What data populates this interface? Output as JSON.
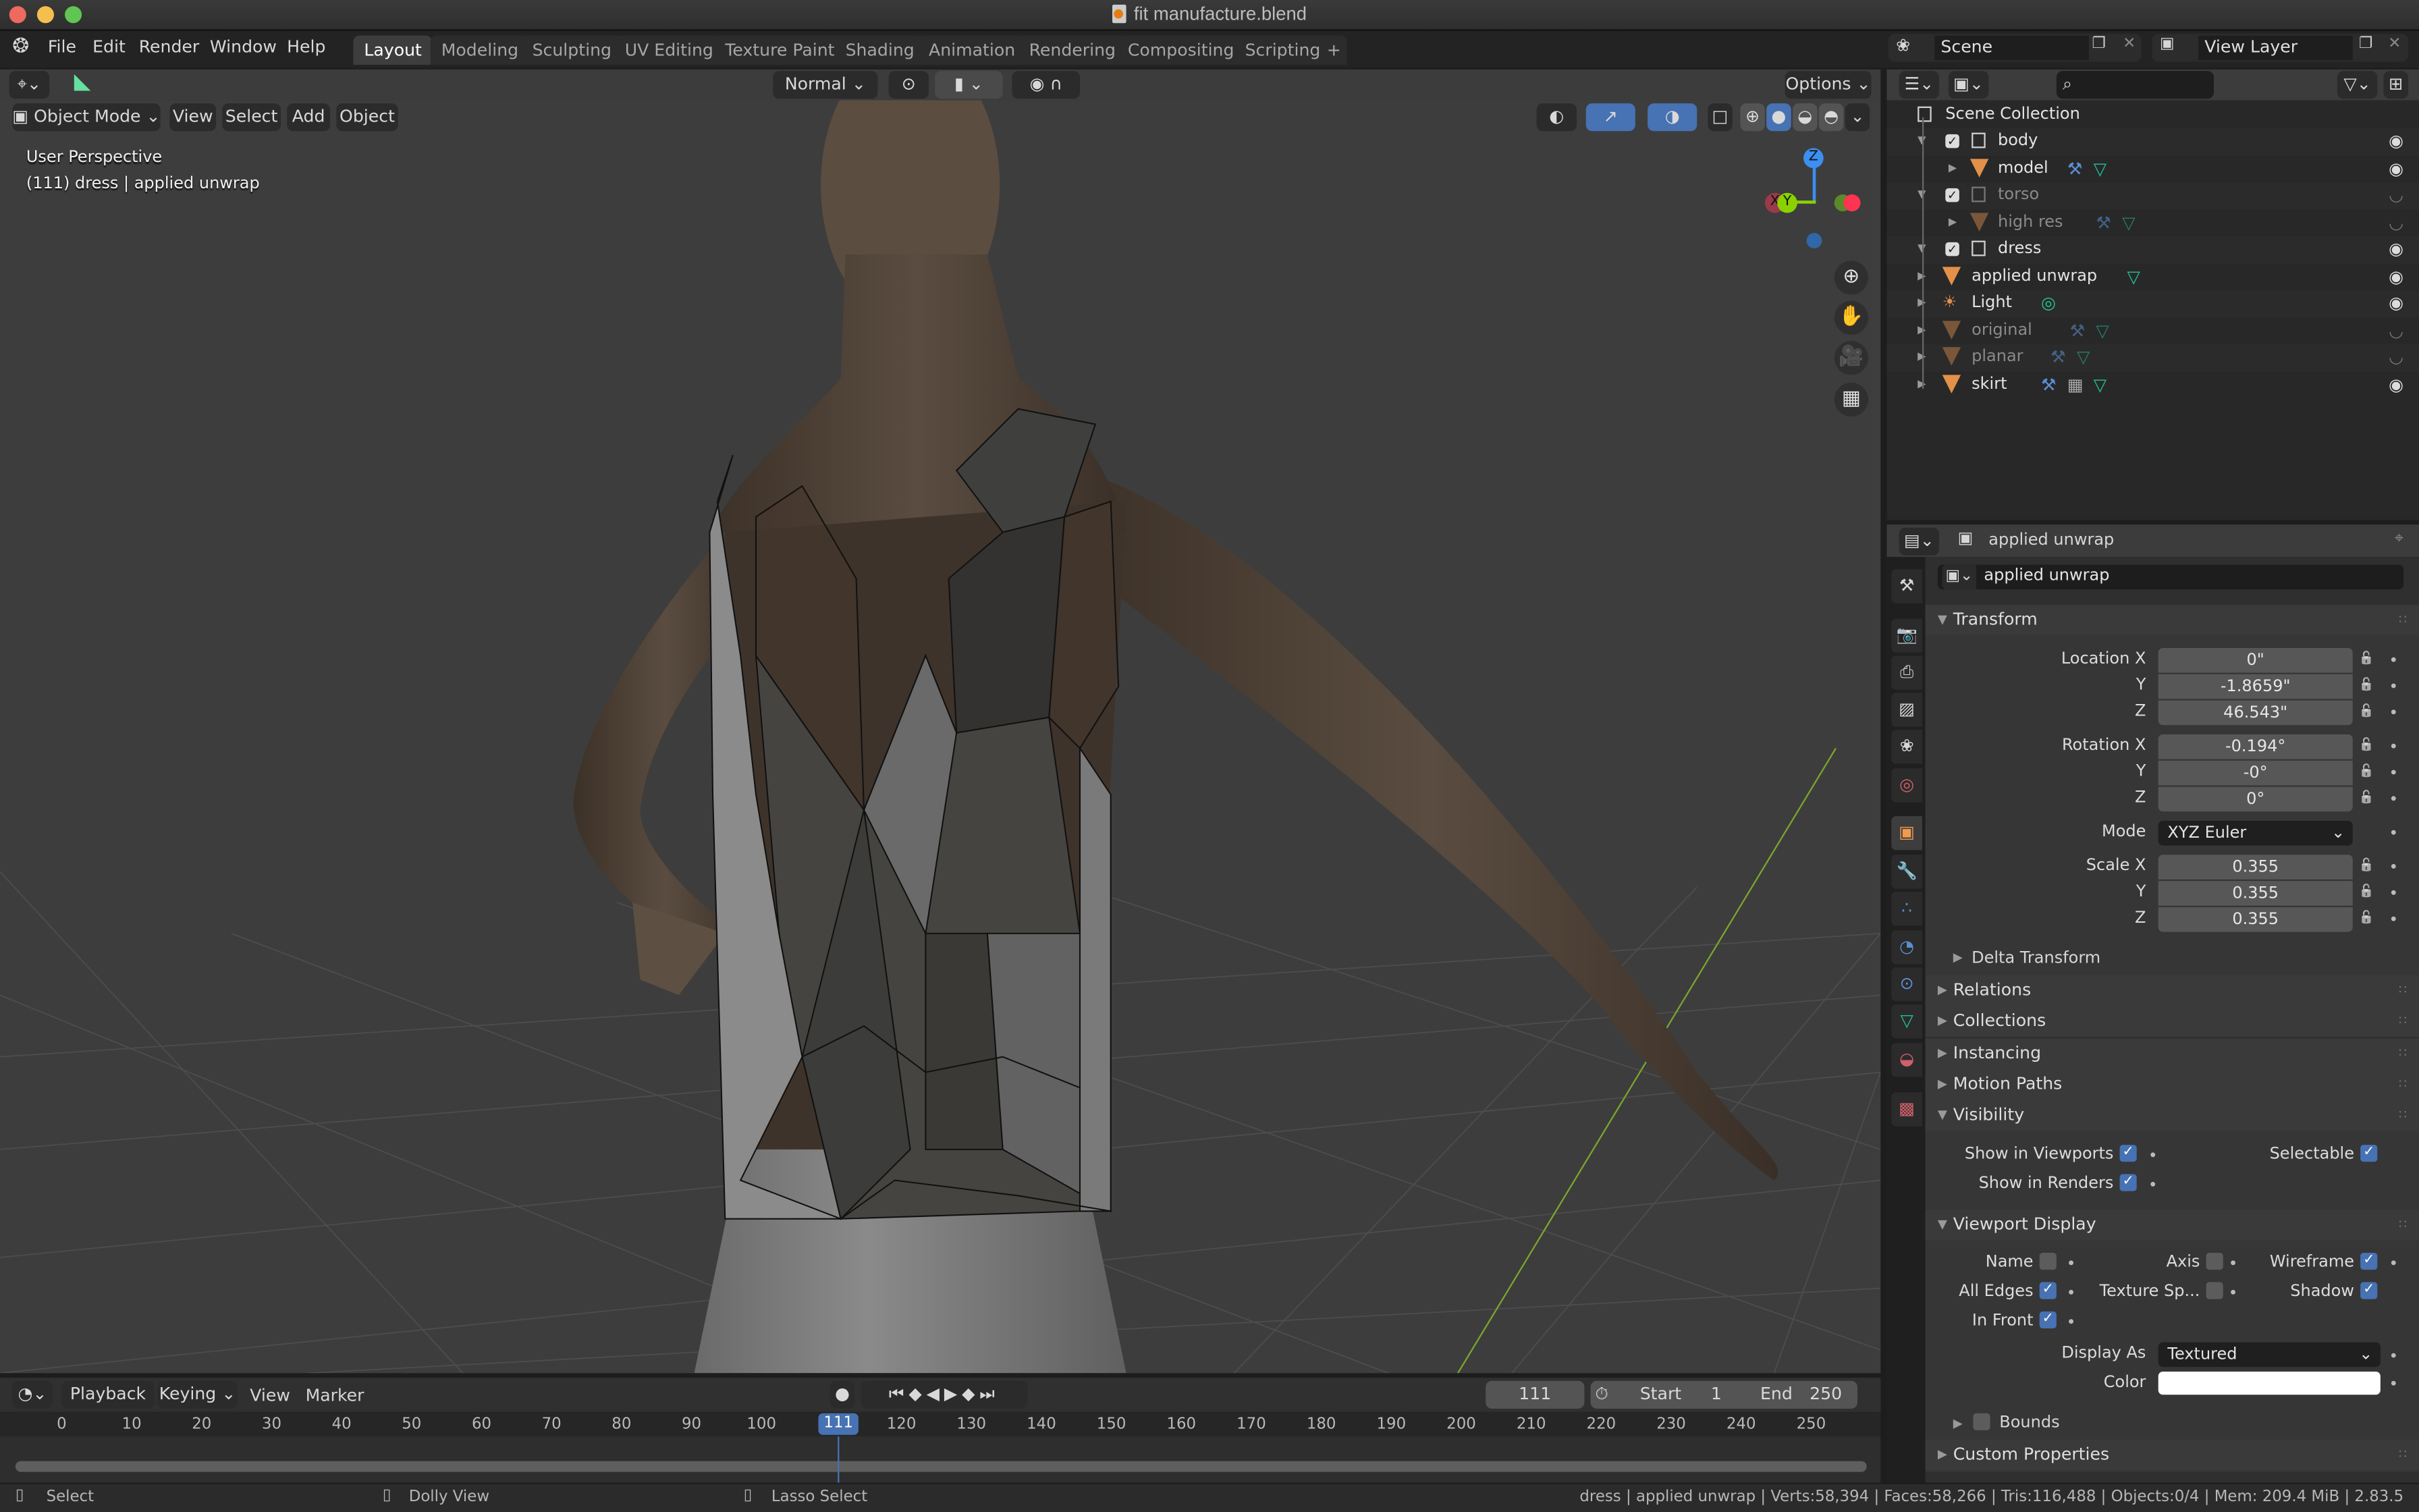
{
  "window": {
    "title": "fit manufacture.blend"
  },
  "menu": [
    "File",
    "Edit",
    "Render",
    "Window",
    "Help"
  ],
  "workspaces": [
    {
      "label": "Layout",
      "active": true
    },
    {
      "label": "Modeling",
      "active": false
    },
    {
      "label": "Sculpting",
      "active": false
    },
    {
      "label": "UV Editing",
      "active": false
    },
    {
      "label": "Texture Paint",
      "active": false
    },
    {
      "label": "Shading",
      "active": false
    },
    {
      "label": "Animation",
      "active": false
    },
    {
      "label": "Rendering",
      "active": false
    },
    {
      "label": "Compositing",
      "active": false
    },
    {
      "label": "Scripting",
      "active": false
    }
  ],
  "add_workspace": "+",
  "scene": {
    "name": "Scene",
    "view_layer": "View Layer"
  },
  "viewport": {
    "tool_header": {
      "orientation": "Normal",
      "options": "Options"
    },
    "header": {
      "mode": "Object Mode",
      "menus": [
        "View",
        "Select",
        "Add",
        "Object"
      ]
    },
    "overlay_text": {
      "perspective": "User Perspective",
      "context": "(111) dress | applied unwrap"
    },
    "gizmo": {
      "z": "Z",
      "y": "Y",
      "x": "X"
    },
    "icons": {
      "zoom": "zoom-in-icon",
      "pan": "hand-icon",
      "camera": "camera-icon",
      "ortho": "grid-icon"
    }
  },
  "timeline": {
    "menus": [
      "Playback",
      "Keying",
      "View",
      "Marker"
    ],
    "current_frame": "111",
    "start_label": "Start",
    "start": "1",
    "end_label": "End",
    "end": "250",
    "ticks": [
      "0",
      "10",
      "20",
      "30",
      "40",
      "50",
      "60",
      "70",
      "80",
      "90",
      "100",
      "111",
      "120",
      "130",
      "140",
      "150",
      "160",
      "170",
      "180",
      "190",
      "200",
      "210",
      "220",
      "230",
      "240",
      "250"
    ]
  },
  "status": {
    "hints": [
      "Select",
      "Dolly View",
      "Lasso Select"
    ],
    "info": "dress | applied unwrap | Verts:58,394 | Faces:58,266 | Tris:116,488 | Objects:0/4 | Mem: 209.4 MiB | 2.83.5"
  },
  "outliner": {
    "root": "Scene Collection",
    "items": [
      {
        "name": "body",
        "type": "collection",
        "visible": true,
        "dim": false
      },
      {
        "name": "model",
        "type": "mesh",
        "visible": true,
        "dim": false
      },
      {
        "name": "torso",
        "type": "collection",
        "visible": false,
        "dim": true
      },
      {
        "name": "high res",
        "type": "mesh",
        "visible": false,
        "dim": true
      },
      {
        "name": "dress",
        "type": "collection",
        "visible": true,
        "dim": false
      },
      {
        "name": "applied unwrap",
        "type": "mesh",
        "visible": true,
        "dim": false
      },
      {
        "name": "Light",
        "type": "light",
        "visible": true,
        "dim": false
      },
      {
        "name": "original",
        "type": "mesh",
        "visible": false,
        "dim": true
      },
      {
        "name": "planar",
        "type": "mesh",
        "visible": false,
        "dim": true
      },
      {
        "name": "skirt",
        "type": "mesh",
        "visible": true,
        "dim": false
      }
    ]
  },
  "properties": {
    "header_name": "applied unwrap",
    "object_name": "applied unwrap",
    "transform": {
      "title": "Transform",
      "location": {
        "label": "Location X",
        "x": "0\"",
        "y": "-1.8659\"",
        "z": "46.543\""
      },
      "rotation": {
        "label": "Rotation X",
        "x": "-0.194°",
        "y": "-0°",
        "z": "0°"
      },
      "mode_label": "Mode",
      "mode": "XYZ Euler",
      "scale": {
        "label": "Scale X",
        "x": "0.355",
        "y": "0.355",
        "z": "0.355"
      },
      "axis_y": "Y",
      "axis_z": "Z"
    },
    "delta_transform": "Delta Transform",
    "collapsed_panels": [
      "Relations",
      "Collections",
      "Instancing",
      "Motion Paths"
    ],
    "visibility": {
      "title": "Visibility",
      "show_viewports": {
        "label": "Show in Viewports",
        "checked": true
      },
      "selectable": {
        "label": "Selectable",
        "checked": true
      },
      "show_renders": {
        "label": "Show in Renders",
        "checked": true
      }
    },
    "viewport_display": {
      "title": "Viewport Display",
      "name": {
        "label": "Name",
        "checked": false
      },
      "axis": {
        "label": "Axis",
        "checked": false
      },
      "wireframe": {
        "label": "Wireframe",
        "checked": true
      },
      "all_edges": {
        "label": "All Edges",
        "checked": true
      },
      "texture_space": {
        "label": "Texture Sp...",
        "checked": false
      },
      "shadow": {
        "label": "Shadow",
        "checked": true
      },
      "in_front": {
        "label": "In Front",
        "checked": true
      },
      "display_as_label": "Display As",
      "display_as": "Textured",
      "color_label": "Color",
      "color": "#ffffff",
      "bounds": {
        "label": "Bounds",
        "checked": false
      }
    },
    "custom_properties": "Custom Properties"
  },
  "colors": {
    "accent": "#4772b3",
    "object_orange": "#e3904a",
    "mesh_green": "#22c29a",
    "modifier_blue": "#5a8fd0"
  }
}
